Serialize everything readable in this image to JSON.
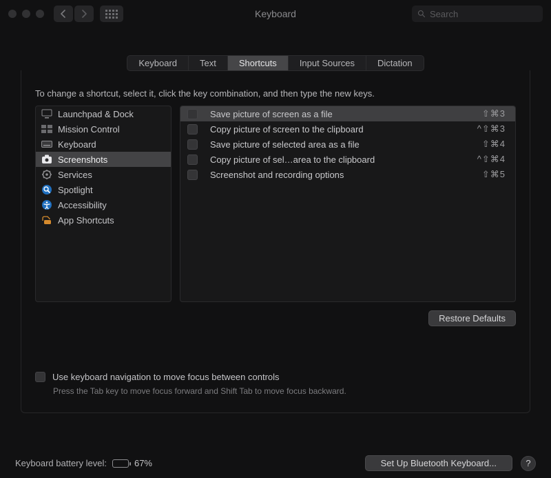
{
  "window": {
    "title": "Keyboard",
    "search_placeholder": "Search"
  },
  "tabs": [
    {
      "label": "Keyboard",
      "active": false
    },
    {
      "label": "Text",
      "active": false
    },
    {
      "label": "Shortcuts",
      "active": true
    },
    {
      "label": "Input Sources",
      "active": false
    },
    {
      "label": "Dictation",
      "active": false
    }
  ],
  "instruction": "To change a shortcut, select it, click the key combination, and then type the new keys.",
  "categories": [
    {
      "label": "Launchpad & Dock",
      "icon": "launchpad",
      "selected": false
    },
    {
      "label": "Mission Control",
      "icon": "mission-control",
      "selected": false
    },
    {
      "label": "Keyboard",
      "icon": "keyboard",
      "selected": false
    },
    {
      "label": "Screenshots",
      "icon": "screenshots",
      "selected": true
    },
    {
      "label": "Services",
      "icon": "services",
      "selected": false
    },
    {
      "label": "Spotlight",
      "icon": "spotlight",
      "selected": false
    },
    {
      "label": "Accessibility",
      "icon": "accessibility",
      "selected": false
    },
    {
      "label": "App Shortcuts",
      "icon": "app-shortcuts",
      "selected": false
    }
  ],
  "shortcuts": [
    {
      "enabled": false,
      "label": "Save picture of screen as a file",
      "keys": "⇧⌘3",
      "highlight": true
    },
    {
      "enabled": false,
      "label": "Copy picture of screen to the clipboard",
      "keys": "^⇧⌘3",
      "highlight": false
    },
    {
      "enabled": false,
      "label": "Save picture of selected area as a file",
      "keys": "⇧⌘4",
      "highlight": false
    },
    {
      "enabled": false,
      "label": "Copy picture of sel…area to the clipboard",
      "keys": "^⇧⌘4",
      "highlight": false
    },
    {
      "enabled": false,
      "label": "Screenshot and recording options",
      "keys": "⇧⌘5",
      "highlight": false
    }
  ],
  "buttons": {
    "restore_defaults": "Restore Defaults",
    "setup_bluetooth": "Set Up Bluetooth Keyboard..."
  },
  "nav_checkbox": {
    "label": "Use keyboard navigation to move focus between controls",
    "hint": "Press the Tab key to move focus forward and Shift Tab to move focus backward.",
    "checked": false
  },
  "footer": {
    "battery_label": "Keyboard battery level:",
    "battery_pct_text": "67%",
    "battery_fill_pct": 67,
    "help": "?"
  }
}
